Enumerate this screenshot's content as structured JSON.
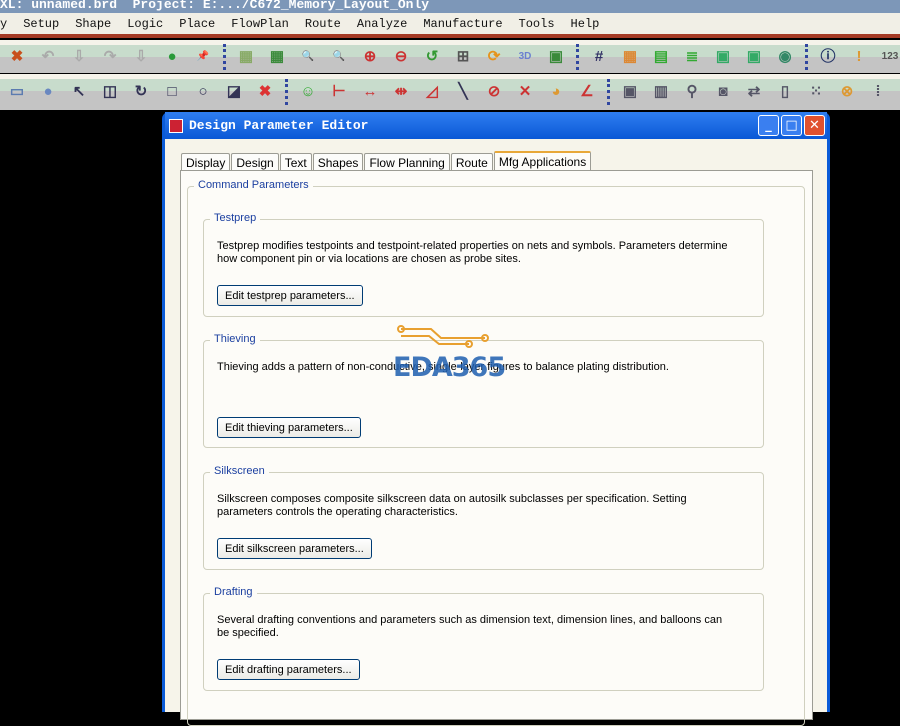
{
  "app": {
    "title": "XL: unnamed.brd  Project: E:.../C672_Memory_Layout_Only"
  },
  "menu": [
    "y",
    "Setup",
    "Shape",
    "Logic",
    "Place",
    "FlowPlan",
    "Route",
    "Analyze",
    "Manufacture",
    "Tools",
    "Help"
  ],
  "toolbar1": [
    {
      "icon": "delete-icon",
      "glyph": "✖",
      "color": "#c8501c"
    },
    {
      "icon": "undo-icon",
      "glyph": "↶",
      "color": "#aaa"
    },
    {
      "icon": "down-icon",
      "glyph": "⇩",
      "color": "#aaa"
    },
    {
      "icon": "redo-icon",
      "glyph": "↷",
      "color": "#aaa"
    },
    {
      "icon": "down-icon",
      "glyph": "⇩",
      "color": "#aaa"
    },
    {
      "icon": "leaf-icon",
      "glyph": "●",
      "color": "#2a9a3a"
    },
    {
      "icon": "pin-icon",
      "glyph": "📌",
      "color": "#2a9a3a"
    },
    {
      "icon": "sep"
    },
    {
      "icon": "grid-icon",
      "glyph": "▦",
      "color": "#8a6"
    },
    {
      "icon": "grid2-icon",
      "glyph": "▦",
      "color": "#3a8a3a"
    },
    {
      "icon": "zoom-fit-icon",
      "glyph": "🔍",
      "color": "#c33"
    },
    {
      "icon": "zoom-window-icon",
      "glyph": "🔍",
      "color": "#c33"
    },
    {
      "icon": "zoom-in-icon",
      "glyph": "⊕",
      "color": "#c33"
    },
    {
      "icon": "zoom-out-icon",
      "glyph": "⊖",
      "color": "#c33"
    },
    {
      "icon": "zoom-previous-icon",
      "glyph": "↺",
      "color": "#393"
    },
    {
      "icon": "zoom-world-icon",
      "glyph": "⊞",
      "color": "#555"
    },
    {
      "icon": "refresh-icon",
      "glyph": "⟳",
      "color": "#e6931c"
    },
    {
      "icon": "3d-icon",
      "glyph": "3D",
      "color": "#6a7fd0"
    },
    {
      "icon": "flip-icon",
      "glyph": "▣",
      "color": "#3a8a3a"
    },
    {
      "icon": "sep"
    },
    {
      "icon": "grid3-icon",
      "glyph": "#",
      "color": "#336"
    },
    {
      "icon": "color-icon",
      "glyph": "▦",
      "color": "#d83"
    },
    {
      "icon": "layers-icon",
      "glyph": "▤",
      "color": "#3a3"
    },
    {
      "icon": "stack-icon",
      "glyph": "≣",
      "color": "#3a3"
    },
    {
      "icon": "cm-icon",
      "glyph": "▣",
      "color": "#3a6"
    },
    {
      "icon": "dfa-icon",
      "glyph": "▣",
      "color": "#3a6"
    },
    {
      "icon": "globe-icon",
      "glyph": "◉",
      "color": "#386"
    },
    {
      "icon": "sep"
    },
    {
      "icon": "info-icon",
      "glyph": "ⓘ",
      "color": "#236"
    },
    {
      "icon": "measure-icon",
      "glyph": "!",
      "color": "#d93"
    },
    {
      "icon": "ruler-icon",
      "glyph": "123",
      "color": "#555"
    }
  ],
  "toolbar2": [
    {
      "icon": "rectangle-icon",
      "glyph": "▭",
      "color": "#5b7bb0"
    },
    {
      "icon": "circle-icon",
      "glyph": "●",
      "color": "#6a88c0"
    },
    {
      "icon": "select-icon",
      "glyph": "↖",
      "color": "#335"
    },
    {
      "icon": "shape-icon",
      "glyph": "◫",
      "color": "#335"
    },
    {
      "icon": "arc-icon",
      "glyph": "↻",
      "color": "#335"
    },
    {
      "icon": "square-icon",
      "glyph": "□",
      "color": "#335"
    },
    {
      "icon": "circle-outline-icon",
      "glyph": "○",
      "color": "#335"
    },
    {
      "icon": "void-icon",
      "glyph": "◪",
      "color": "#335"
    },
    {
      "icon": "delete-shape-icon",
      "glyph": "✖",
      "color": "#d33"
    },
    {
      "icon": "sep"
    },
    {
      "icon": "component-icon",
      "glyph": "☺",
      "color": "#3a3"
    },
    {
      "icon": "dimension-icon",
      "glyph": "⊢",
      "color": "#c33"
    },
    {
      "icon": "dim-linear-icon",
      "glyph": "↔",
      "color": "#c33"
    },
    {
      "icon": "dim-datum-icon",
      "glyph": "⇹",
      "color": "#c33"
    },
    {
      "icon": "angle-icon",
      "glyph": "◿",
      "color": "#c33"
    },
    {
      "icon": "line-icon",
      "glyph": "╲",
      "color": "#335"
    },
    {
      "icon": "radius-icon",
      "glyph": "⊘",
      "color": "#c33"
    },
    {
      "icon": "cross-icon",
      "glyph": "✕",
      "color": "#c33"
    },
    {
      "icon": "balloon-icon",
      "glyph": "◕",
      "color": "#d93"
    },
    {
      "icon": "leader-icon",
      "glyph": "∠",
      "color": "#c33"
    },
    {
      "icon": "sep"
    },
    {
      "icon": "odb-icon",
      "glyph": "▣",
      "color": "#556"
    },
    {
      "icon": "book-icon",
      "glyph": "▥",
      "color": "#556"
    },
    {
      "icon": "test-icon",
      "glyph": "⚲",
      "color": "#556"
    },
    {
      "icon": "camera-icon",
      "glyph": "◙",
      "color": "#556"
    },
    {
      "icon": "refdes-icon",
      "glyph": "⇄",
      "color": "#556"
    },
    {
      "icon": "doc-icon",
      "glyph": "▯",
      "color": "#556"
    },
    {
      "icon": "grid-dots-icon",
      "glyph": "⁙",
      "color": "#556"
    },
    {
      "icon": "probe-icon",
      "glyph": "⊗",
      "color": "#d93"
    },
    {
      "icon": "matrix-icon",
      "glyph": "⁞",
      "color": "#556"
    }
  ],
  "dialog": {
    "title": "Design Parameter Editor",
    "tabs": [
      "Display",
      "Design",
      "Text",
      "Shapes",
      "Flow Planning",
      "Route",
      "Mfg Applications"
    ],
    "active_tab": "Mfg Applications",
    "outer_group": "Command Parameters",
    "groups": [
      {
        "label": "Testprep",
        "description": "Testprep modifies testpoints and testpoint-related properties on nets and symbols.  Parameters determine how component pin or via locations are chosen as probe sites.",
        "button": "Edit testprep parameters..."
      },
      {
        "label": "Thieving",
        "description": "Thieving adds a pattern of non-conductive, single-layer figures to balance plating distribution.",
        "button": "Edit thieving parameters..."
      },
      {
        "label": "Silkscreen",
        "description": "Silkscreen composes composite silkscreen data on autosilk subclasses per specification.  Setting parameters controls the operating characteristics.",
        "button": "Edit silkscreen parameters..."
      },
      {
        "label": "Drafting",
        "description": "Several drafting conventions and parameters such as dimension text, dimension lines, and balloons can be specified.",
        "button": "Edit drafting parameters..."
      }
    ]
  },
  "watermark": "EDA365"
}
